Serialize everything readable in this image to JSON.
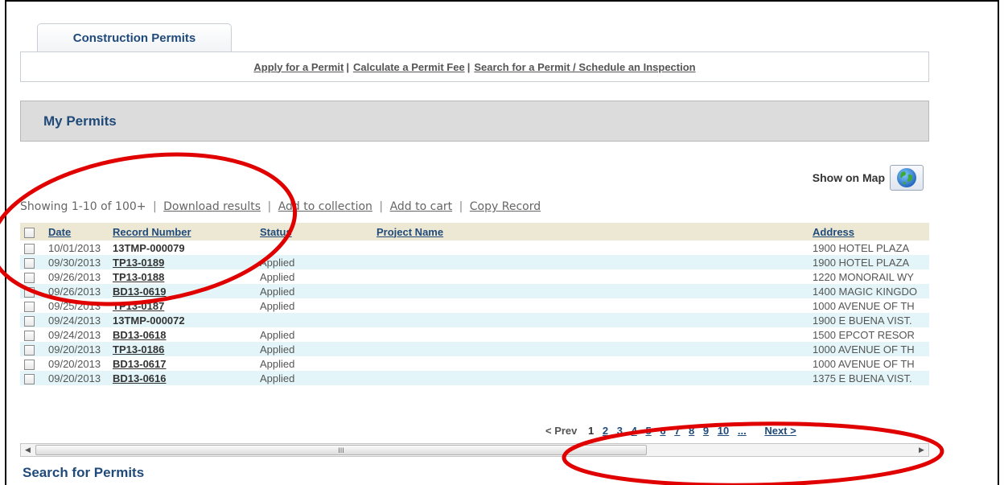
{
  "tab": {
    "label": "Construction Permits"
  },
  "subnav": {
    "links": [
      "Apply for a Permit",
      "Calculate a Permit Fee",
      "Search for a Permit / Schedule an Inspection"
    ],
    "separator": "|"
  },
  "section": {
    "title": "My Permits"
  },
  "map": {
    "label": "Show on Map",
    "icon": "globe-icon"
  },
  "toolbar": {
    "showing": "Showing 1-10 of 100+",
    "separator": "|",
    "download": "Download results",
    "add_collection": "Add to collection",
    "add_cart": "Add to cart",
    "copy": "Copy Record"
  },
  "table": {
    "headers": {
      "date": "Date",
      "record": "Record Number",
      "status": "Status",
      "project": "Project Name",
      "address": "Address"
    },
    "rows": [
      {
        "date": "10/01/2013",
        "record": "13TMP-000079",
        "status": "",
        "address": "1900 HOTEL PLAZA"
      },
      {
        "date": "09/30/2013",
        "record": "TP13-0189",
        "status": "Applied",
        "address": "1900 HOTEL PLAZA"
      },
      {
        "date": "09/26/2013",
        "record": "TP13-0188",
        "status": "Applied",
        "address": "1220 MONORAIL WY"
      },
      {
        "date": "09/26/2013",
        "record": "BD13-0619",
        "status": "Applied",
        "address": "1400 MAGIC KINGDO"
      },
      {
        "date": "09/25/2013",
        "record": "TP13-0187",
        "status": "Applied",
        "address": "1000 AVENUE OF TH"
      },
      {
        "date": "09/24/2013",
        "record": "13TMP-000072",
        "status": "",
        "address": "1900 E BUENA VIST."
      },
      {
        "date": "09/24/2013",
        "record": "BD13-0618",
        "status": "Applied",
        "address": "1500 EPCOT RESOR"
      },
      {
        "date": "09/20/2013",
        "record": "TP13-0186",
        "status": "Applied",
        "address": "1000 AVENUE OF TH"
      },
      {
        "date": "09/20/2013",
        "record": "BD13-0617",
        "status": "Applied",
        "address": "1000 AVENUE OF TH"
      },
      {
        "date": "09/20/2013",
        "record": "BD13-0616",
        "status": "Applied",
        "address": "1375 E BUENA VIST."
      }
    ]
  },
  "pager": {
    "prev": "< Prev",
    "pages": [
      "1",
      "2",
      "3",
      "4",
      "5",
      "6",
      "7",
      "8",
      "9",
      "10"
    ],
    "ellipsis": "...",
    "next": "Next >",
    "current": "1"
  },
  "scrollbar": {
    "grip": "III"
  },
  "search_heading": "Search for Permits",
  "colors": {
    "accent": "#1f4a7a",
    "row_alt": "#e3f5f8",
    "header_bg": "#ede8d4",
    "annotation": "#e00000"
  }
}
